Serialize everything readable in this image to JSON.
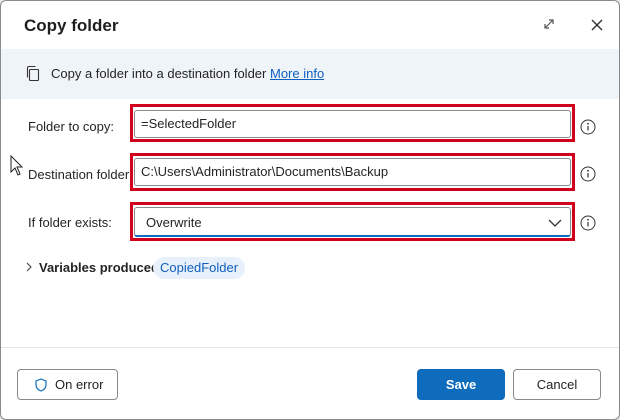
{
  "dialog": {
    "title": "Copy folder",
    "expand_icon": "expand-icon",
    "close_icon": "close-icon"
  },
  "banner": {
    "icon": "copy-icon",
    "text": "Copy a folder into a destination folder",
    "link": "More info"
  },
  "fields": {
    "folder_to_copy": {
      "label": "Folder to copy:",
      "value": "=SelectedFolder"
    },
    "destination_folder": {
      "label": "Destination folder:",
      "value": "C:\\Users\\Administrator\\Documents\\Backup"
    },
    "if_folder_exists": {
      "label": "If folder exists:",
      "value": "Overwrite"
    }
  },
  "variables": {
    "label": "Variables produced",
    "items": [
      "CopiedFolder"
    ]
  },
  "footer": {
    "on_error": "On error",
    "save": "Save",
    "cancel": "Cancel"
  },
  "colors": {
    "accent": "#0f6cbd",
    "highlight_border": "#d1001c",
    "banner_bg": "#eff4f9"
  }
}
